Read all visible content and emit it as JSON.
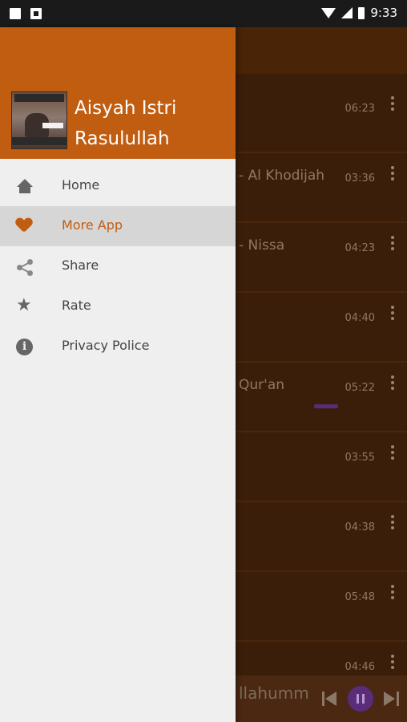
{
  "status_bar": {
    "time": "9:33"
  },
  "drawer": {
    "app_title_line1": "Aisyah Istri",
    "app_title_line2": "Rasulullah",
    "logo_text_top": "Aisyah",
    "logo_text_mid": "Istri",
    "items": [
      {
        "label": "Home",
        "icon": "home-icon",
        "active": false
      },
      {
        "label": "More App",
        "icon": "heart-icon",
        "active": true
      },
      {
        "label": "Share",
        "icon": "share-icon",
        "active": false
      },
      {
        "label": "Rate",
        "icon": "star-icon",
        "active": false
      },
      {
        "label": "Privacy Police",
        "icon": "info-icon",
        "active": false
      }
    ]
  },
  "background_list": {
    "rows": [
      {
        "title_fragment": "",
        "duration": "06:23"
      },
      {
        "title_fragment": "- Al Khodijah",
        "duration": "03:36"
      },
      {
        "title_fragment": "- Nissa",
        "duration": "04:23"
      },
      {
        "title_fragment": "",
        "duration": "04:40"
      },
      {
        "title_fragment": "Qur'an",
        "duration": "05:22"
      },
      {
        "title_fragment": "",
        "duration": "03:55"
      },
      {
        "title_fragment": "",
        "duration": "04:38"
      },
      {
        "title_fragment": "",
        "duration": "05:48"
      },
      {
        "title_fragment": "",
        "duration": "04:46"
      }
    ]
  },
  "player": {
    "title_fragment": "llahumm"
  },
  "colors": {
    "accent": "#c05d11",
    "drawer_bg": "#efefef",
    "background_app": "#3b1e0a"
  }
}
